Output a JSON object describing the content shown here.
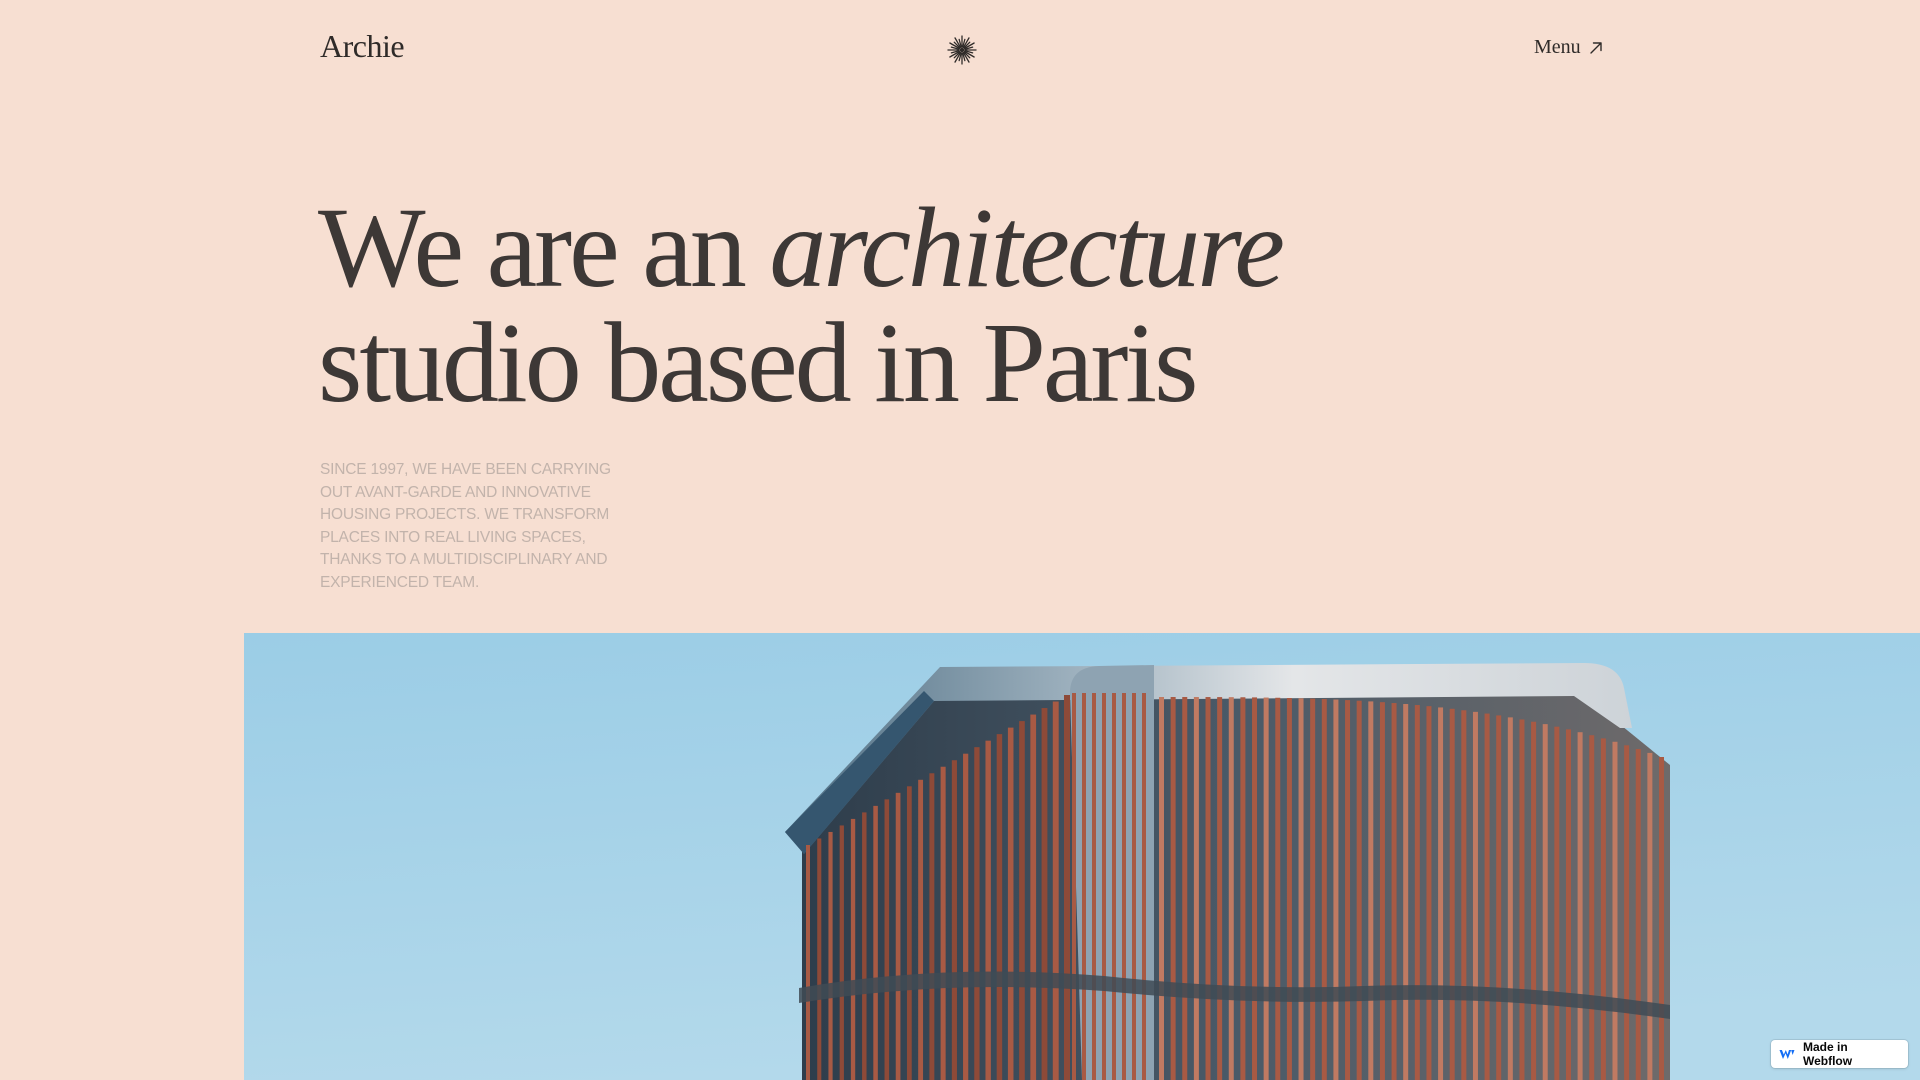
{
  "header": {
    "brand": "Archie",
    "brand_mark_icon": "starburst-icon",
    "menu_label": "Menu",
    "menu_icon": "arrow-up-right-icon"
  },
  "hero": {
    "title_line1_plain": "We are an ",
    "title_line1_italic": "architecture",
    "title_line2": "studio based in Paris",
    "description": "SINCE 1997, WE HAVE BEEN CARRYING OUT AVANT-GARDE AND INNOVATIVE HOUSING PROJECTS. WE TRANSFORM PLACES INTO REAL LIVING SPACES, THANKS TO A MULTIDISCIPLINARY AND EXPERIENCED TEAM."
  },
  "badge": {
    "label": "Made in Webflow",
    "icon": "webflow-logo-icon"
  },
  "colors": {
    "background": "#f7dfd2",
    "heading": "#3d3836",
    "description": "#c2b3ab",
    "sky": "#a8d3e8",
    "facade": "#a85a44"
  }
}
